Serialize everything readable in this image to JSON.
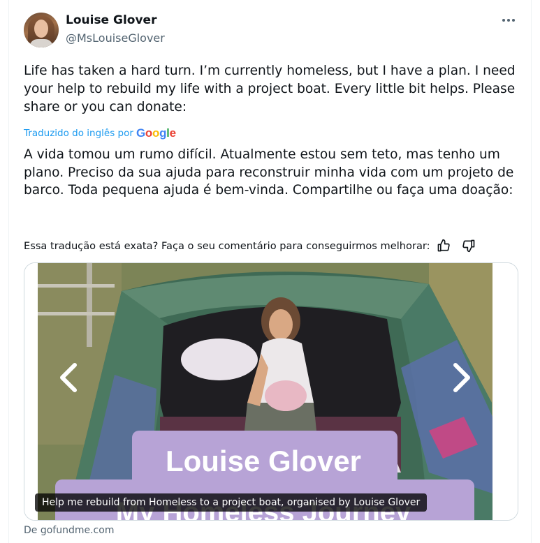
{
  "author": {
    "display_name": "Louise Glover",
    "handle": "@MsLouiseGlover",
    "avatar_icon": "profile-photo"
  },
  "menu": {
    "more_icon": "more-horizontal-icon",
    "more_glyph": "•••"
  },
  "tweet": {
    "text_original": "Life has taken a hard turn. I’m currently homeless, but I have a plan. I need your help to rebuild my life with a project boat. Every little bit helps. Please share or you can donate:",
    "translated_by": "Traduzido do inglês por",
    "translation_provider": "Google",
    "text_translated": "A vida tomou um rumo difícil. Atualmente estou sem teto, mas tenho um plano. Preciso da sua ajuda para reconstruir minha vida com um projeto de barco. Toda pequena ajuda é bem-vinda. Compartilhe ou faça uma doação:",
    "feedback_prompt": "Essa tradução está exata? Faça o seu comentário para conseguirmos melhorar:"
  },
  "card": {
    "image_banner_name": "Louise Glover",
    "image_banner_subtitle": "My Homeless Journey",
    "caption": "Help me rebuild from Homeless to a project boat, organised by Louise Glover",
    "source": "De gofundme.com"
  },
  "colors": {
    "link_blue": "#1d9bf0",
    "secondary_text": "#536471",
    "primary_text": "#0f1419",
    "banner_purple": "#b7a3d6"
  }
}
